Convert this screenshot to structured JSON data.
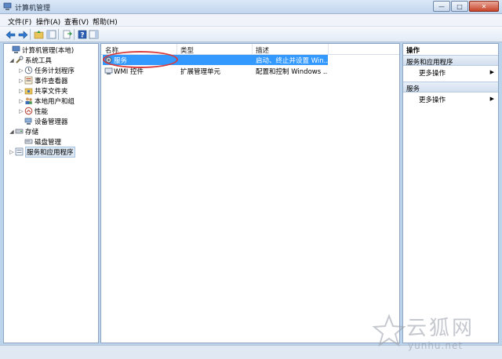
{
  "window": {
    "title": "计算机管理",
    "minimize_glyph": "—",
    "maximize_glyph": "□",
    "close_glyph": "✕"
  },
  "menu": {
    "items": [
      {
        "label": "文件(F)"
      },
      {
        "label": "操作(A)"
      },
      {
        "label": "查看(V)"
      },
      {
        "label": "帮助(H)"
      }
    ]
  },
  "toolbar": {
    "buttons": [
      "back-arrow-icon",
      "forward-arrow-icon",
      "up-folder-icon",
      "show-hide-tree-icon",
      "export-list-icon",
      "help-icon",
      "show-hide-action-pane-icon"
    ]
  },
  "tree": {
    "root": "计算机管理(本地)",
    "system_tools": "系统工具",
    "task_scheduler": "任务计划程序",
    "event_viewer": "事件查看器",
    "shared_folders": "共享文件夹",
    "local_users": "本地用户和组",
    "performance": "性能",
    "device_manager": "设备管理器",
    "storage": "存储",
    "disk_management": "磁盘管理",
    "services_apps": "服务和应用程序",
    "expand_glyph": "▷",
    "collapse_glyph": "◢"
  },
  "list": {
    "columns": {
      "name": "名称",
      "type": "类型",
      "description": "描述"
    },
    "rows": [
      {
        "name": "服务",
        "type": "",
        "description": "启动、终止并设置 Win..."
      },
      {
        "name": "WMI 控件",
        "type": "扩展管理单元",
        "description": "配置和控制 Windows ..."
      }
    ]
  },
  "actions": {
    "title": "操作",
    "section1": {
      "header": "服务和应用程序",
      "more": "更多操作"
    },
    "section2": {
      "header": "服务",
      "more": "更多操作"
    },
    "arrow_glyph": "▶"
  },
  "watermark": {
    "text": "云狐网",
    "url": "yunhu.net"
  },
  "colors": {
    "selection": "#3399ff",
    "highlight_ring": "#d93a3a",
    "titlebar": "#c3d6ee"
  }
}
